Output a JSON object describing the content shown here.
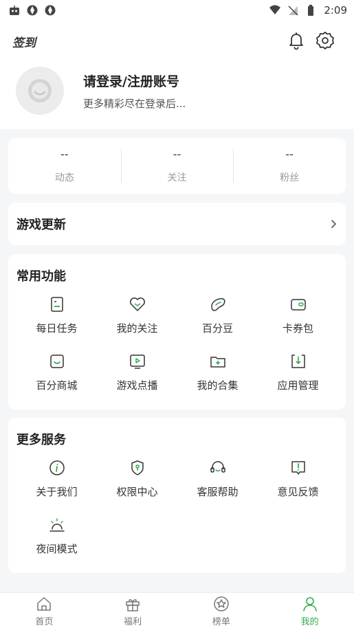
{
  "status_bar": {
    "time": "2:09"
  },
  "header": {
    "signin_label": "签到"
  },
  "profile": {
    "title": "请登录/注册账号",
    "subtitle": "更多精彩尽在登录后..."
  },
  "stats": [
    {
      "value": "--",
      "label": "动态"
    },
    {
      "value": "--",
      "label": "关注"
    },
    {
      "value": "--",
      "label": "粉丝"
    }
  ],
  "game_update": {
    "title": "游戏更新"
  },
  "common_functions": {
    "title": "常用功能",
    "items": [
      {
        "label": "每日任务",
        "icon": "task-icon"
      },
      {
        "label": "我的关注",
        "icon": "heart-icon"
      },
      {
        "label": "百分豆",
        "icon": "bean-icon"
      },
      {
        "label": "卡券包",
        "icon": "wallet-icon"
      },
      {
        "label": "百分商城",
        "icon": "shop-bag-icon"
      },
      {
        "label": "游戏点播",
        "icon": "play-icon"
      },
      {
        "label": "我的合集",
        "icon": "folder-add-icon"
      },
      {
        "label": "应用管理",
        "icon": "download-icon"
      }
    ]
  },
  "more_services": {
    "title": "更多服务",
    "items": [
      {
        "label": "关于我们",
        "icon": "info-icon"
      },
      {
        "label": "权限中心",
        "icon": "shield-key-icon"
      },
      {
        "label": "客服帮助",
        "icon": "headset-icon"
      },
      {
        "label": "意见反馈",
        "icon": "feedback-icon"
      },
      {
        "label": "夜间模式",
        "icon": "night-mode-icon"
      }
    ]
  },
  "tabbar": {
    "tabs": [
      {
        "label": "首页",
        "icon": "home-icon",
        "active": false
      },
      {
        "label": "福利",
        "icon": "gift-icon",
        "active": false
      },
      {
        "label": "榜单",
        "icon": "star-icon",
        "active": false
      },
      {
        "label": "我的",
        "icon": "user-icon",
        "active": true
      }
    ]
  },
  "colors": {
    "accent": "#2eac4e",
    "icon_stroke": "#333333",
    "background": "#f5f6f7"
  }
}
